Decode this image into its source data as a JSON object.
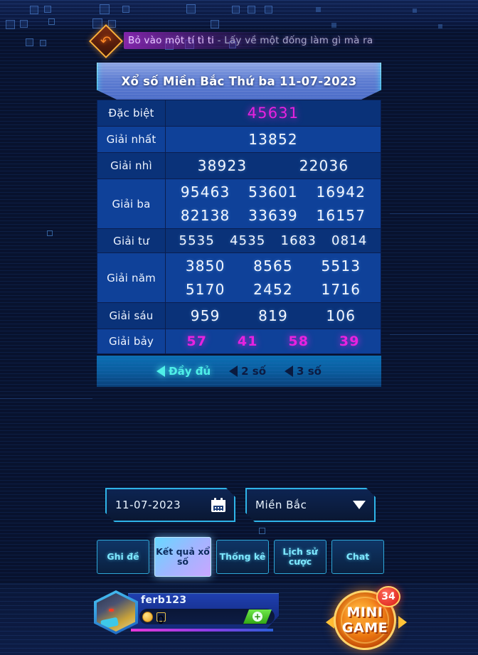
{
  "marquee": {
    "icon": "back-arrow-icon",
    "text_highlight": "Bỏ vào một tí tì ti",
    "text_rest": " - Lấy về một đống làm gì mà ra"
  },
  "panel": {
    "title": "Xổ số Miền Bắc Thứ ba 11-07-2023",
    "rows": [
      {
        "label": "Đặc biệt",
        "style": "special",
        "lines": [
          [
            "45631"
          ]
        ]
      },
      {
        "label": "Giải nhất",
        "style": "plain",
        "lines": [
          [
            "13852"
          ]
        ]
      },
      {
        "label": "Giải nhì",
        "style": "plain",
        "lines": [
          [
            "38923",
            "22036"
          ]
        ]
      },
      {
        "label": "Giải ba",
        "style": "plain",
        "lines": [
          [
            "95463",
            "53601",
            "16942"
          ],
          [
            "82138",
            "33639",
            "16157"
          ]
        ]
      },
      {
        "label": "Giải tư",
        "style": "plain",
        "lines": [
          [
            "5535",
            "4535",
            "1683",
            "0814"
          ]
        ]
      },
      {
        "label": "Giải năm",
        "style": "plain",
        "lines": [
          [
            "3850",
            "8565",
            "5513"
          ],
          [
            "5170",
            "2452",
            "1716"
          ]
        ]
      },
      {
        "label": "Giải sáu",
        "style": "plain",
        "lines": [
          [
            "959",
            "819",
            "106"
          ]
        ]
      },
      {
        "label": "Giải bảy",
        "style": "pink",
        "lines": [
          [
            "57",
            "41",
            "58",
            "39"
          ]
        ]
      }
    ]
  },
  "filters": [
    {
      "label": "Đầy đủ",
      "active": true
    },
    {
      "label": "2 số",
      "active": false
    },
    {
      "label": "3 số",
      "active": false
    }
  ],
  "controls": {
    "date_value": "11-07-2023",
    "date_icon": "calendar-icon",
    "region_value": "Miền Bắc",
    "region_icon": "chevron-down-icon"
  },
  "nav": [
    {
      "label": "Ghi đề",
      "active": false
    },
    {
      "label": "Kết quả xổ số",
      "active": true
    },
    {
      "label": "Thống kê",
      "active": false
    },
    {
      "label": "Lịch sử cược",
      "active": false
    },
    {
      "label": "Chat",
      "active": false
    }
  ],
  "player": {
    "name": "ferb123",
    "balance": "0",
    "coin_icon": "coin-icon",
    "add_label": "+"
  },
  "minigame": {
    "line1": "MINI",
    "line2": "GAME",
    "badge_count": "34"
  },
  "colors": {
    "page_bg": "#08122e",
    "row_dark": "#0a3279",
    "row_light": "#0f4199",
    "accent_cyan": "#4ff0e8",
    "magenta": "#e822e0",
    "header_blue": "#5f7ed2"
  }
}
